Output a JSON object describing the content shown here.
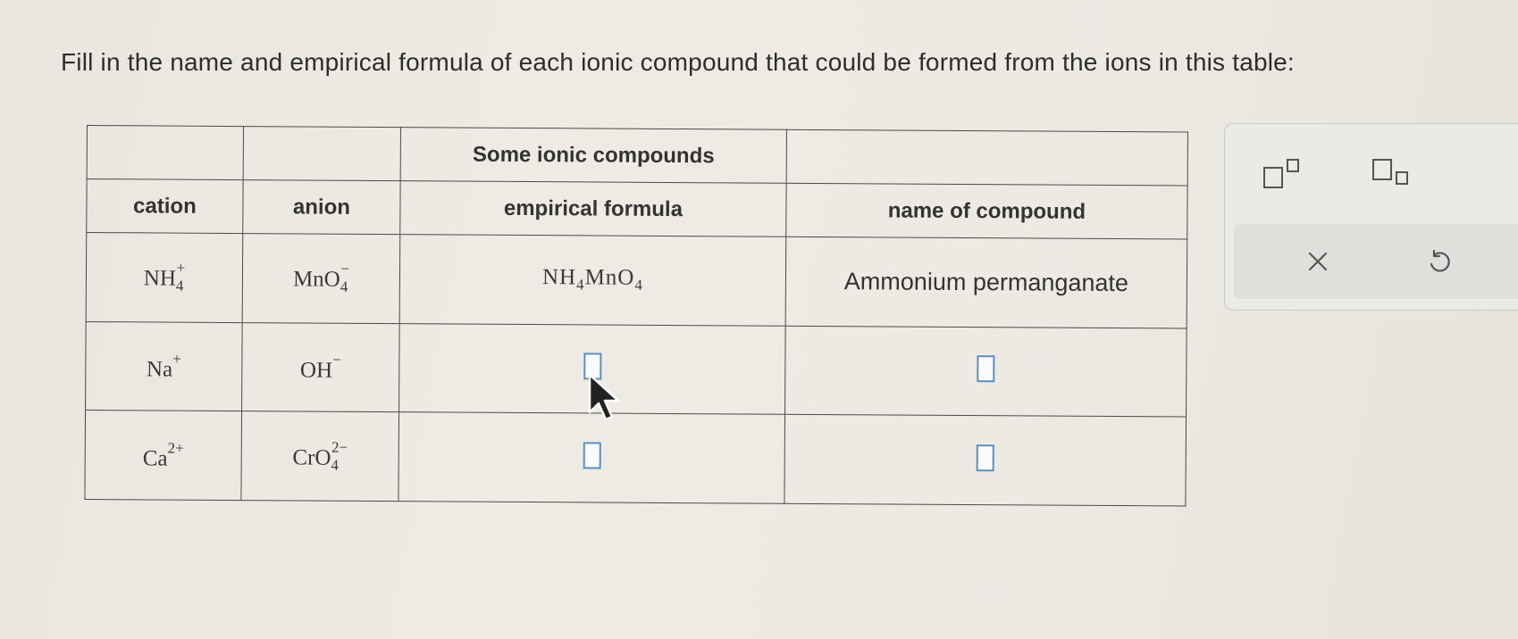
{
  "prompt": "Fill in the name and empirical formula of each ionic compound that could be formed from the ions in this table:",
  "table": {
    "caption": "Some ionic compounds",
    "headers": {
      "cation": "cation",
      "anion": "anion",
      "formula": "empirical formula",
      "name": "name of compound"
    },
    "rows": [
      {
        "cation": {
          "base": "NH",
          "sub": "4",
          "sup": "+"
        },
        "anion": {
          "base": "MnO",
          "sub": "4",
          "sup": "−"
        },
        "formula": {
          "p1": "NH",
          "s1": "4",
          "p2": "MnO",
          "s2": "4"
        },
        "name": "Ammonium permanganate"
      },
      {
        "cation": {
          "base": "Na",
          "sub": "",
          "sup": "+"
        },
        "anion": {
          "base": "OH",
          "sub": "",
          "sup": "−"
        },
        "formula": null,
        "name": null
      },
      {
        "cation": {
          "base": "Ca",
          "sub": "",
          "sup": "2+"
        },
        "anion": {
          "base": "CrO",
          "sub": "4",
          "sup": "2−"
        },
        "formula": null,
        "name": null
      }
    ]
  },
  "toolbar": {
    "superscript_icon": "superscript-icon",
    "subscript_icon": "subscript-icon",
    "clear_icon": "clear-icon",
    "undo_icon": "undo-icon"
  },
  "colors": {
    "answer_box_border": "#5a8fc4",
    "tool_icon": "#555555"
  }
}
